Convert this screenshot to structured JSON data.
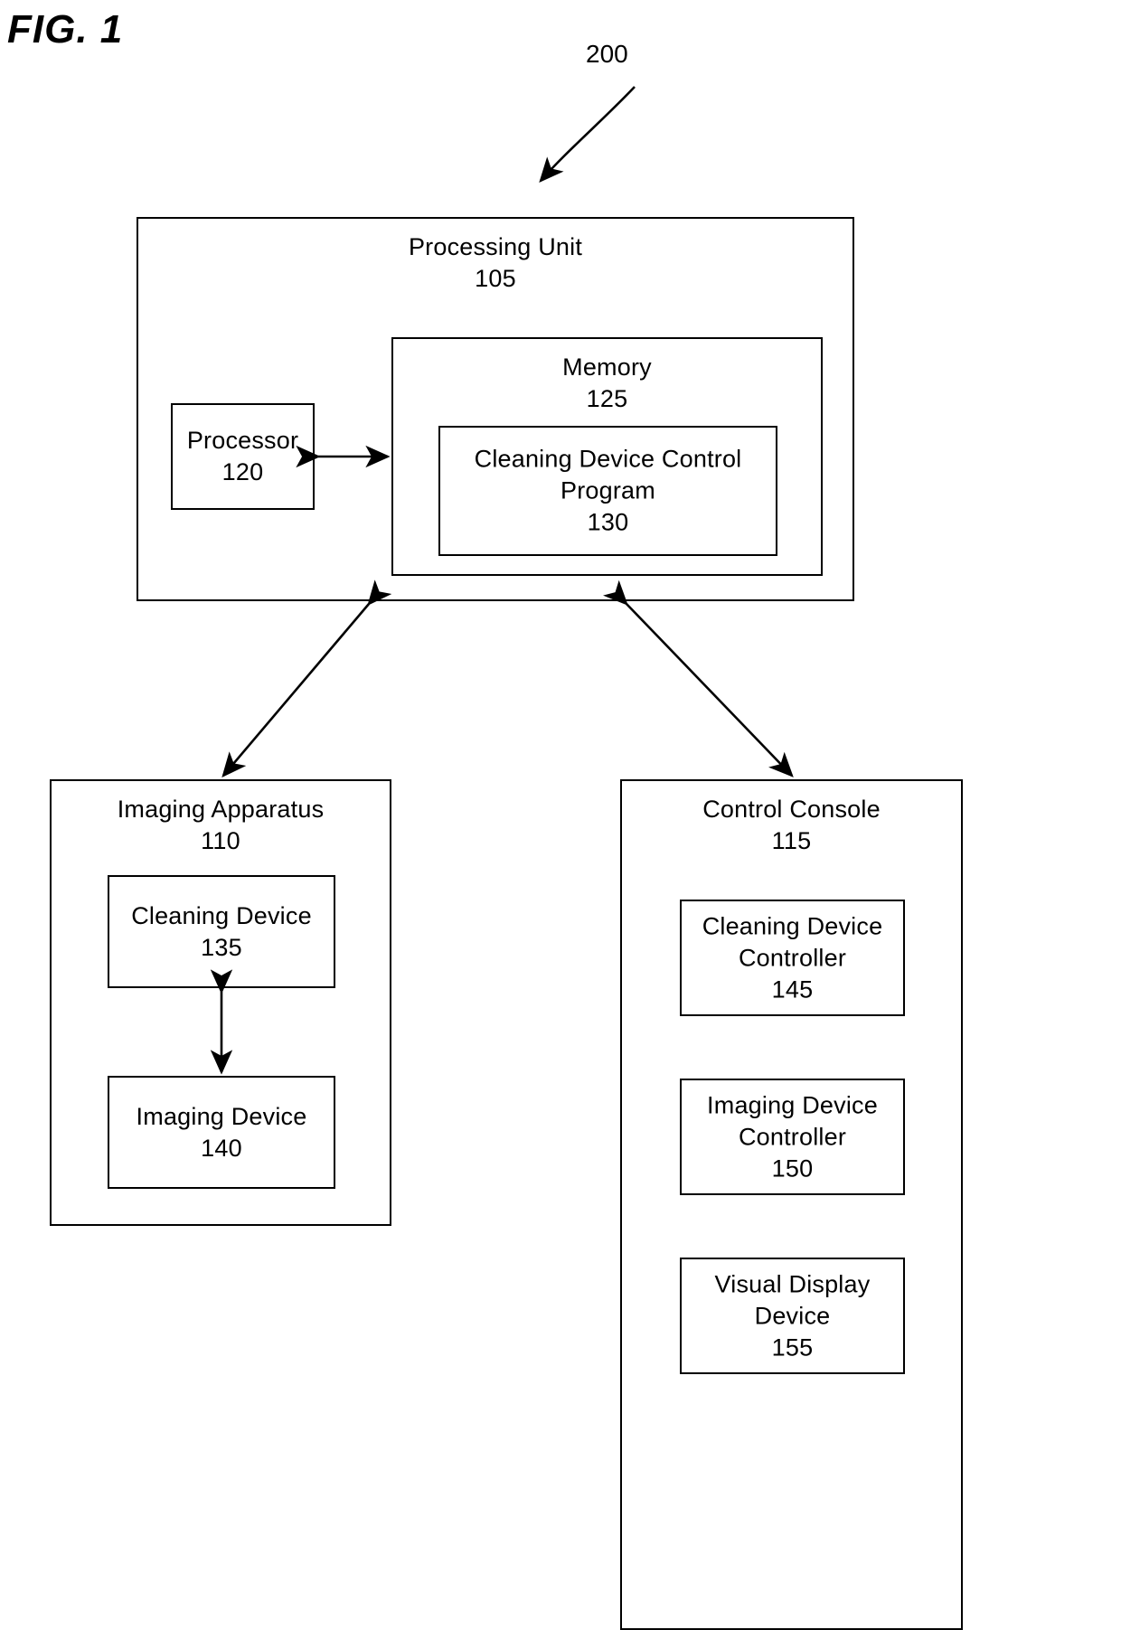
{
  "figure": {
    "title": "FIG. 1",
    "system_reference": "200"
  },
  "blocks": {
    "processing_unit": {
      "name": "Processing Unit",
      "ref": "105",
      "label": "Processing Unit\n105"
    },
    "processor": {
      "name": "Processor",
      "ref": "120",
      "label": "Processor\n120"
    },
    "memory": {
      "name": "Memory",
      "ref": "125",
      "label": "Memory\n125"
    },
    "cleaning_device_control_program": {
      "name": "Cleaning Device Control Program",
      "ref": "130",
      "label": "Cleaning Device Control\nProgram\n130"
    },
    "imaging_apparatus": {
      "name": "Imaging Apparatus",
      "ref": "110",
      "label": "Imaging Apparatus\n110"
    },
    "cleaning_device": {
      "name": "Cleaning Device",
      "ref": "135",
      "label": "Cleaning Device\n135"
    },
    "imaging_device": {
      "name": "Imaging Device",
      "ref": "140",
      "label": "Imaging Device\n140"
    },
    "control_console": {
      "name": "Control Console",
      "ref": "115",
      "label": "Control Console\n115"
    },
    "cleaning_device_controller": {
      "name": "Cleaning Device Controller",
      "ref": "145",
      "label": "Cleaning Device\nController\n145"
    },
    "imaging_device_controller": {
      "name": "Imaging Device Controller",
      "ref": "150",
      "label": "Imaging Device\nController\n150"
    },
    "visual_display_device": {
      "name": "Visual Display Device",
      "ref": "155",
      "label": "Visual Display\nDevice\n155"
    }
  },
  "connectors": [
    {
      "name": "processor-to-memory",
      "kind": "double-arrow"
    },
    {
      "name": "processing-unit-to-imaging-apparatus",
      "kind": "double-arrow"
    },
    {
      "name": "processing-unit-to-control-console",
      "kind": "double-arrow"
    },
    {
      "name": "cleaning-device-to-imaging-device",
      "kind": "double-arrow"
    },
    {
      "name": "system-reference-leader",
      "kind": "curved-arrow"
    }
  ],
  "style": {
    "stroke": "#000000",
    "background": "#ffffff"
  }
}
